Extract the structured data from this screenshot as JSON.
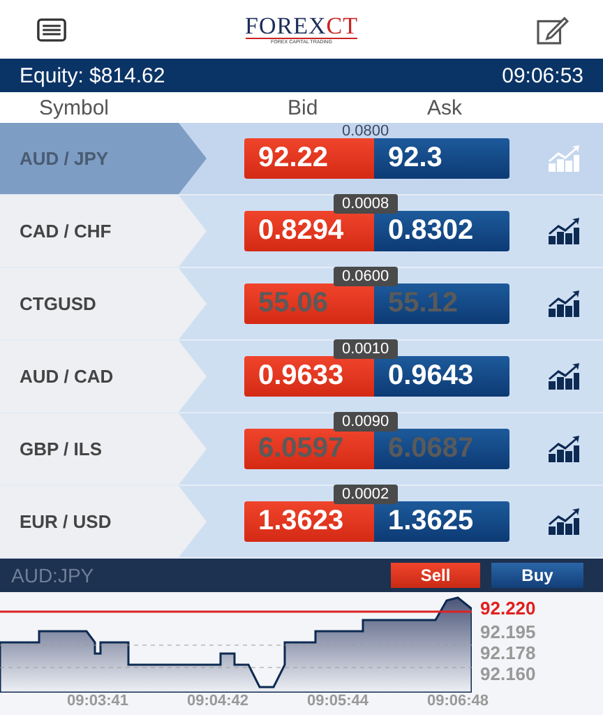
{
  "header": {
    "logo": "FOREX",
    "logo_accent": "CT",
    "tagline": "FOREX CAPITAL TRADING"
  },
  "equity_bar": {
    "equity": "Equity: $814.62",
    "time": "09:06:53"
  },
  "columns": [
    "Symbol",
    "Bid",
    "Ask"
  ],
  "rows": [
    {
      "symbol": "AUD / JPY",
      "bid": "92.22",
      "ask": "92.3",
      "spread": "0.0800",
      "selected": true,
      "stale": false
    },
    {
      "symbol": "CAD / CHF",
      "bid": "0.8294",
      "ask": "0.8302",
      "spread": "0.0008",
      "selected": false,
      "stale": false
    },
    {
      "symbol": "CTGUSD",
      "bid": "55.06",
      "ask": "55.12",
      "spread": "0.0600",
      "selected": false,
      "stale": true
    },
    {
      "symbol": "AUD / CAD",
      "bid": "0.9633",
      "ask": "0.9643",
      "spread": "0.0010",
      "selected": false,
      "stale": false
    },
    {
      "symbol": "GBP / ILS",
      "bid": "6.0597",
      "ask": "6.0687",
      "spread": "0.0090",
      "selected": false,
      "stale": true
    },
    {
      "symbol": "EUR / USD",
      "bid": "1.3623",
      "ask": "1.3625",
      "spread": "0.0002",
      "selected": false,
      "stale": false
    }
  ],
  "trade_bar": {
    "symbol": "AUD:JPY",
    "sell": "Sell",
    "buy": "Buy"
  },
  "chart": {
    "price": "92.220",
    "y_labels": [
      "92.195",
      "92.178",
      "92.160"
    ],
    "x_labels": [
      "09:03:41",
      "09:04:42",
      "09:05:44",
      "09:06:48"
    ]
  }
}
